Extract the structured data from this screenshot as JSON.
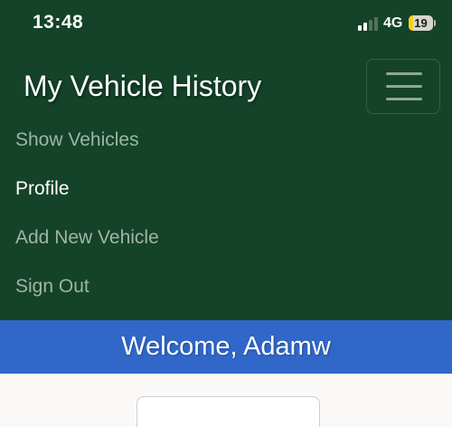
{
  "status_bar": {
    "time": "13:48",
    "network": "4G",
    "battery_level": "19",
    "battery_fill_fraction": 0.19,
    "signal_bars_active": 2,
    "signal_bars_total": 4,
    "icons": [
      "signal-icon",
      "battery-icon"
    ]
  },
  "navbar": {
    "brand": "My Vehicle History",
    "toggle_icon": "hamburger-menu-icon",
    "items": [
      {
        "label": "Show Vehicles",
        "active": false
      },
      {
        "label": "Profile",
        "active": true
      },
      {
        "label": "Add New Vehicle",
        "active": false
      },
      {
        "label": "Sign Out",
        "active": false
      }
    ]
  },
  "banner": {
    "text": "Welcome, Adamw"
  },
  "colors": {
    "navbar_bg": "#14432a",
    "banner_bg": "#3167c8",
    "content_bg": "#faf9f7",
    "nav_link": "#9fb5a6",
    "nav_link_active": "#ffffff",
    "battery_low": "#f7d117",
    "signal_active": "#ffffff",
    "signal_inactive": "#55705e"
  }
}
